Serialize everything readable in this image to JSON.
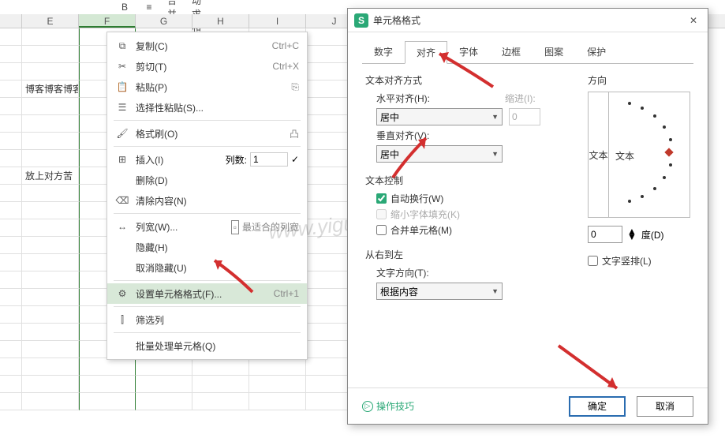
{
  "toolbar": {
    "merge": "合并",
    "autosum": "自动求和"
  },
  "columns": [
    "E",
    "F",
    "G",
    "H",
    "I",
    "J"
  ],
  "selected_col": "F",
  "cells": {
    "blog_text": "博客博客博客博客",
    "put_text": "放上对方苦"
  },
  "context_menu": {
    "copy": "复制(C)",
    "copy_sc": "Ctrl+C",
    "cut": "剪切(T)",
    "cut_sc": "Ctrl+X",
    "paste": "粘贴(P)",
    "paste_special": "选择性粘贴(S)...",
    "format_painter": "格式刷(O)",
    "insert": "插入(I)",
    "insert_cols_label": "列数:",
    "insert_cols_val": "1",
    "delete": "删除(D)",
    "clear": "清除内容(N)",
    "col_width": "列宽(W)...",
    "best_fit": "最适合的列宽",
    "hide": "隐藏(H)",
    "unhide": "取消隐藏(U)",
    "format_cells": "设置单元格格式(F)...",
    "format_cells_sc": "Ctrl+1",
    "filter": "筛选列",
    "batch": "批量处理单元格(Q)"
  },
  "dialog": {
    "title": "单元格格式",
    "tabs": [
      "数字",
      "对齐",
      "字体",
      "边框",
      "图案",
      "保护"
    ],
    "active_tab": "对齐",
    "text_align_section": "文本对齐方式",
    "h_align_label": "水平对齐(H):",
    "h_align_value": "居中",
    "indent_label": "缩进(I):",
    "indent_value": "0",
    "v_align_label": "垂直对齐(V):",
    "v_align_value": "居中",
    "text_control_section": "文本控制",
    "wrap": "自动换行(W)",
    "shrink": "缩小字体填充(K)",
    "merge": "合并单元格(M)",
    "rtl_section": "从右到左",
    "text_dir_label": "文字方向(T):",
    "text_dir_value": "根据内容",
    "orientation_label": "方向",
    "orient_v_text": "文本",
    "orient_h_text": "文本",
    "degree_value": "0",
    "degree_label": "度(D)",
    "vertical_text": "文字竖排(L)",
    "tips": "操作技巧",
    "ok": "确定",
    "cancel": "取消"
  },
  "watermark": "www.yigujin.cn"
}
